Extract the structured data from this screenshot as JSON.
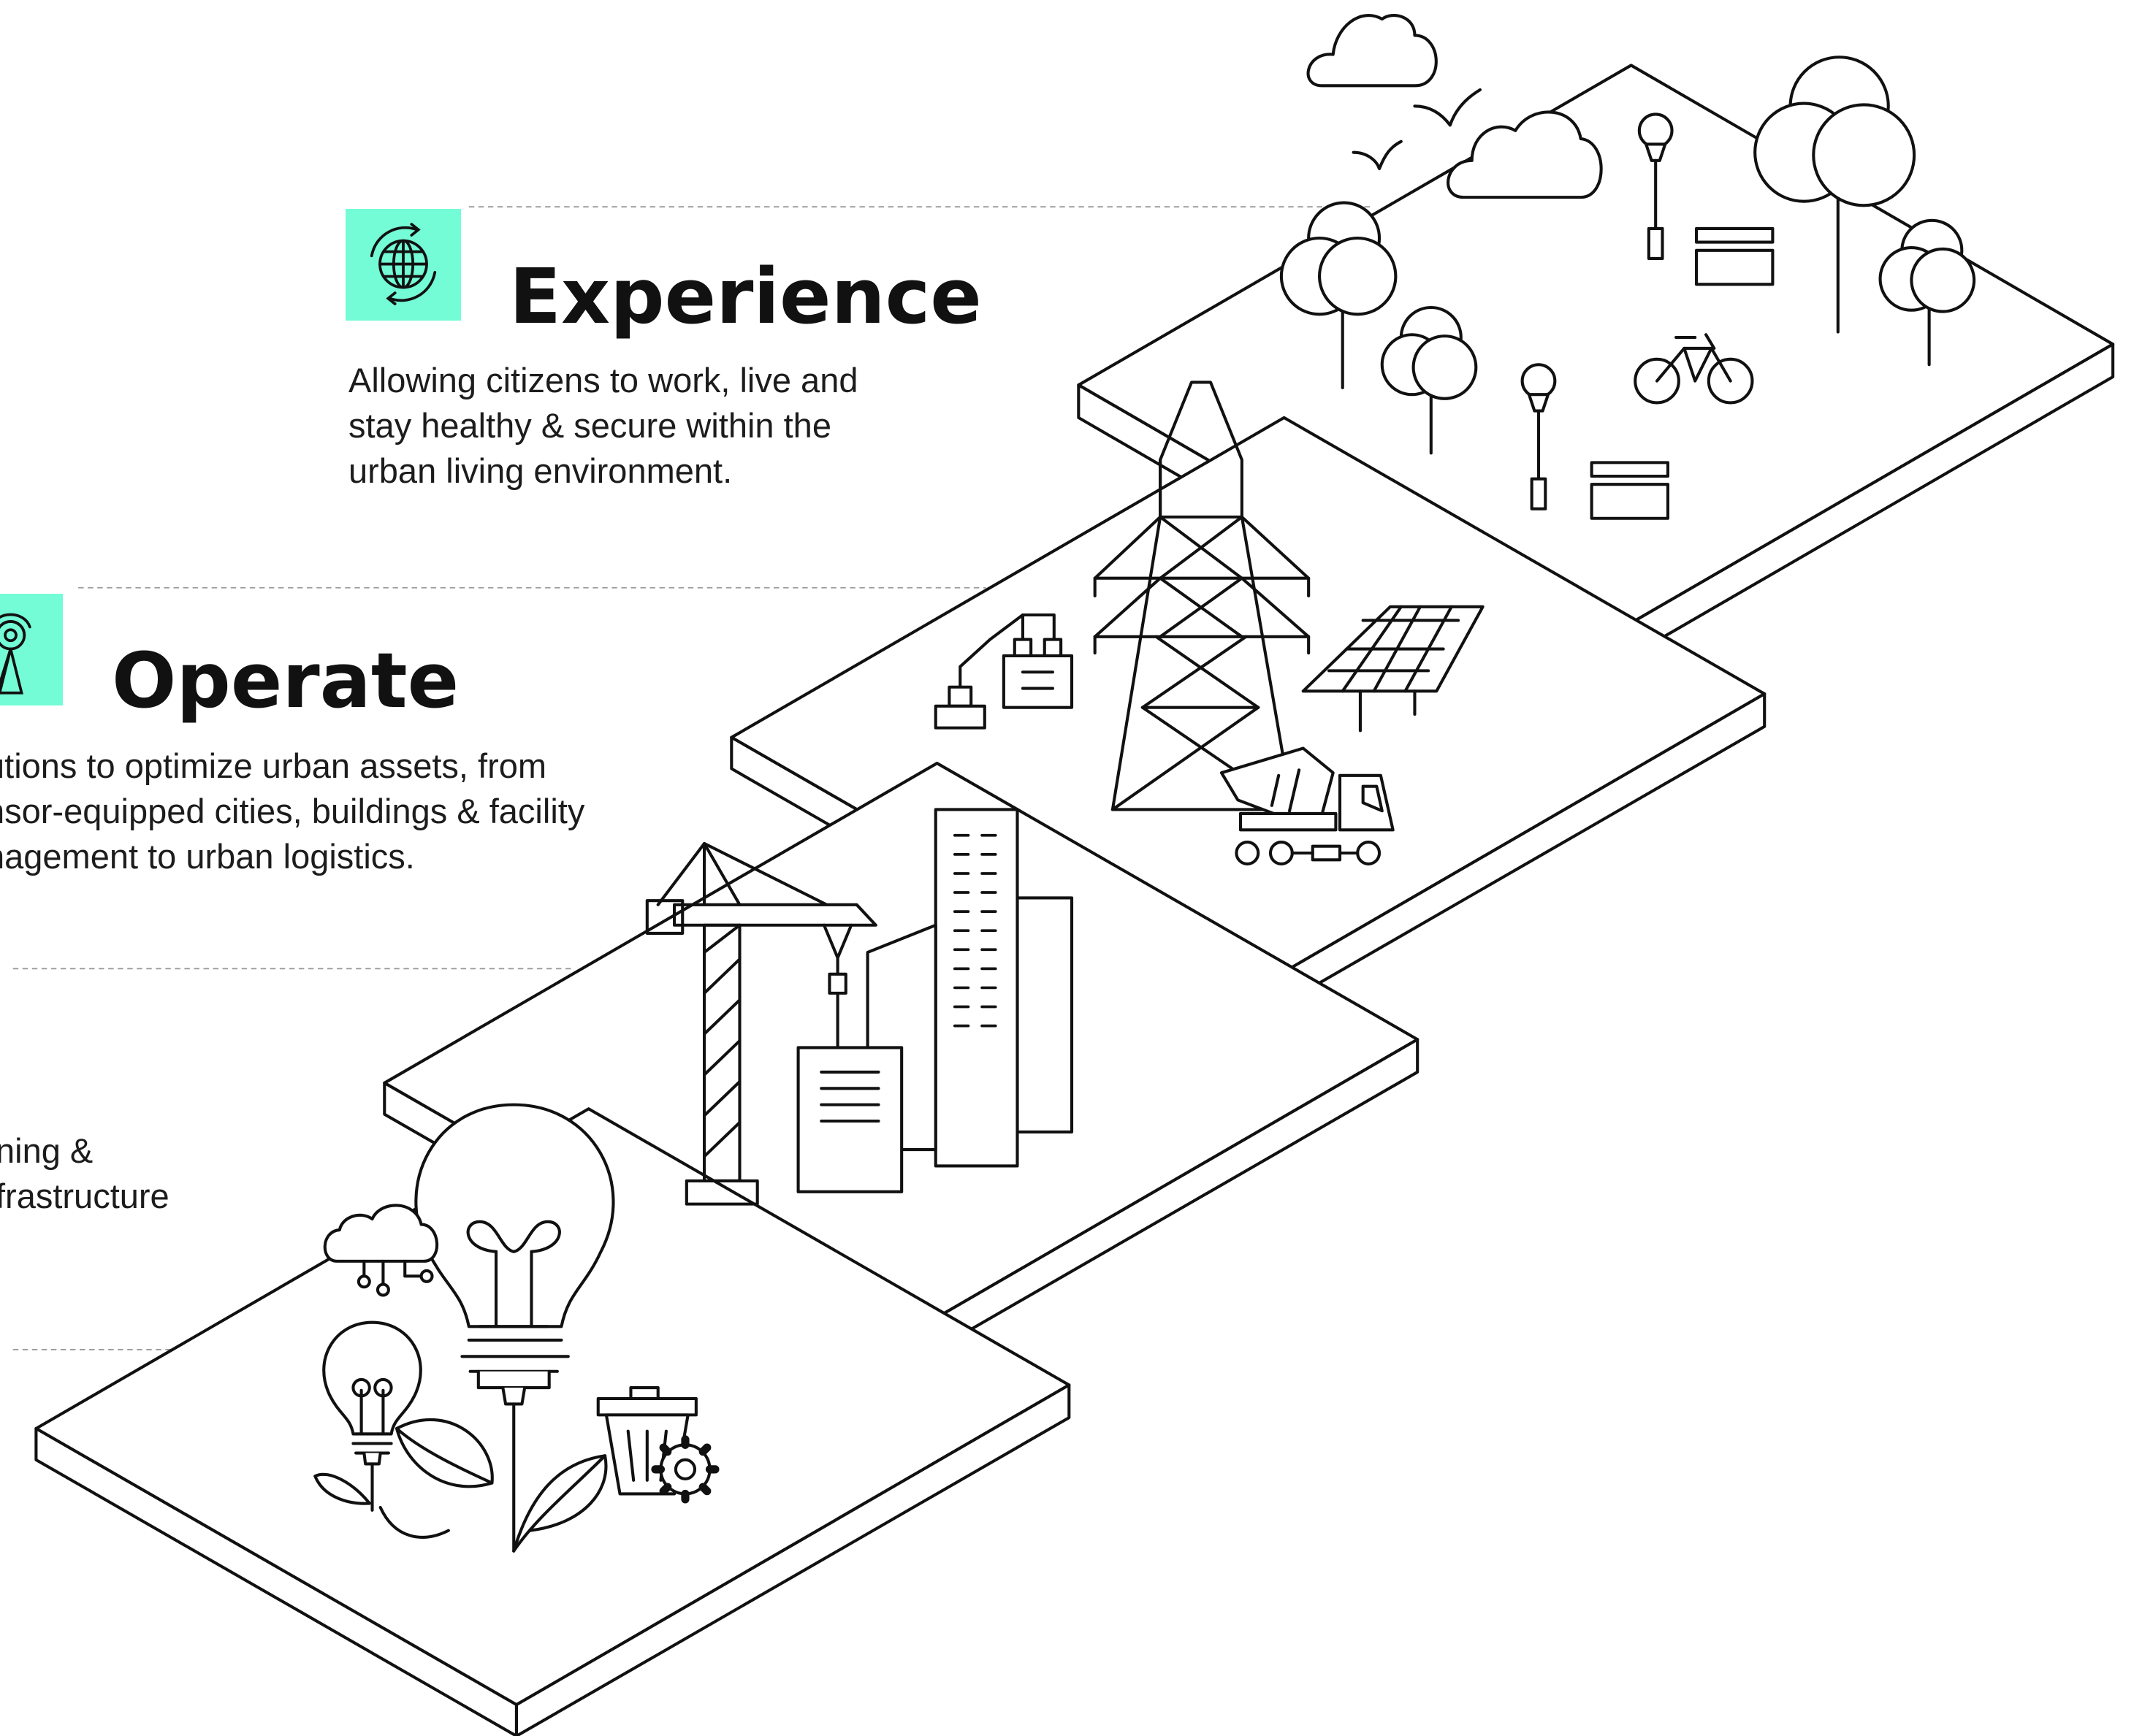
{
  "stages": [
    {
      "title": "Experience",
      "description": "Allowing citizens to work, live and stay healthy & secure within the urban living environment.",
      "icon": "globe-refresh-icon"
    },
    {
      "title": "Operate",
      "description": "utions to optimize urban assets, from nsor-equipped cities, buildings & facility nagement to urban logistics.",
      "icon": "signal-tower-icon"
    },
    {
      "title": "",
      "description": "ning & frastructure",
      "icon": ""
    }
  ],
  "colors": {
    "accent": "#73fcd6",
    "line": "#111111",
    "text": "#1c1c1c",
    "dash": "#9a9a9a"
  }
}
